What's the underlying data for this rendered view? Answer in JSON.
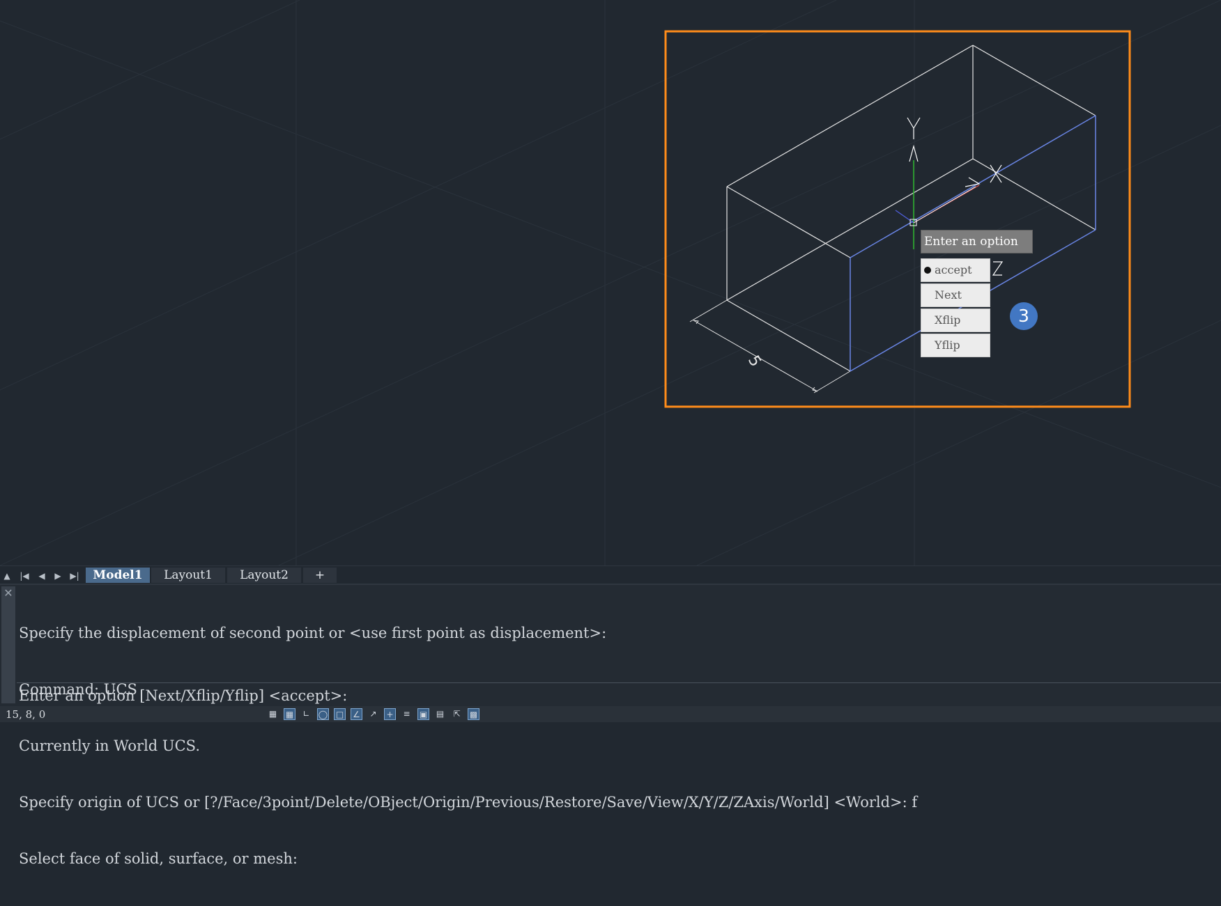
{
  "tabs": {
    "model": "Model1",
    "layout1": "Layout1",
    "layout2": "Layout2",
    "add": "+"
  },
  "command_history": [
    "Specify the displacement of second point or <use first point as displacement>:",
    "Command: UCS",
    "Currently in World UCS.",
    "Specify origin of UCS or [?/Face/3point/Delete/OBject/Origin/Previous/Restore/Save/View/X/Y/Z/ZAxis/World] <World>: f",
    "Select face of solid, surface, or mesh:"
  ],
  "command_prompt": "Enter an option [Next/Xflip/Yflip] <accept>:",
  "tooltip": "Enter an option",
  "options_menu": [
    "accept",
    "Next",
    "Xflip",
    "Yflip"
  ],
  "selected_option": "accept",
  "badge": "3",
  "dimension_value": "5",
  "axis_labels": {
    "y": "Y",
    "z": "Z"
  },
  "status": {
    "coords": "15, 8, 0"
  },
  "colors": {
    "background": "#212830",
    "highlight_frame": "#ff8c1a",
    "selected_face": "#6a86e6",
    "badge": "#4277c3",
    "active_tab": "#4a6a8c"
  }
}
